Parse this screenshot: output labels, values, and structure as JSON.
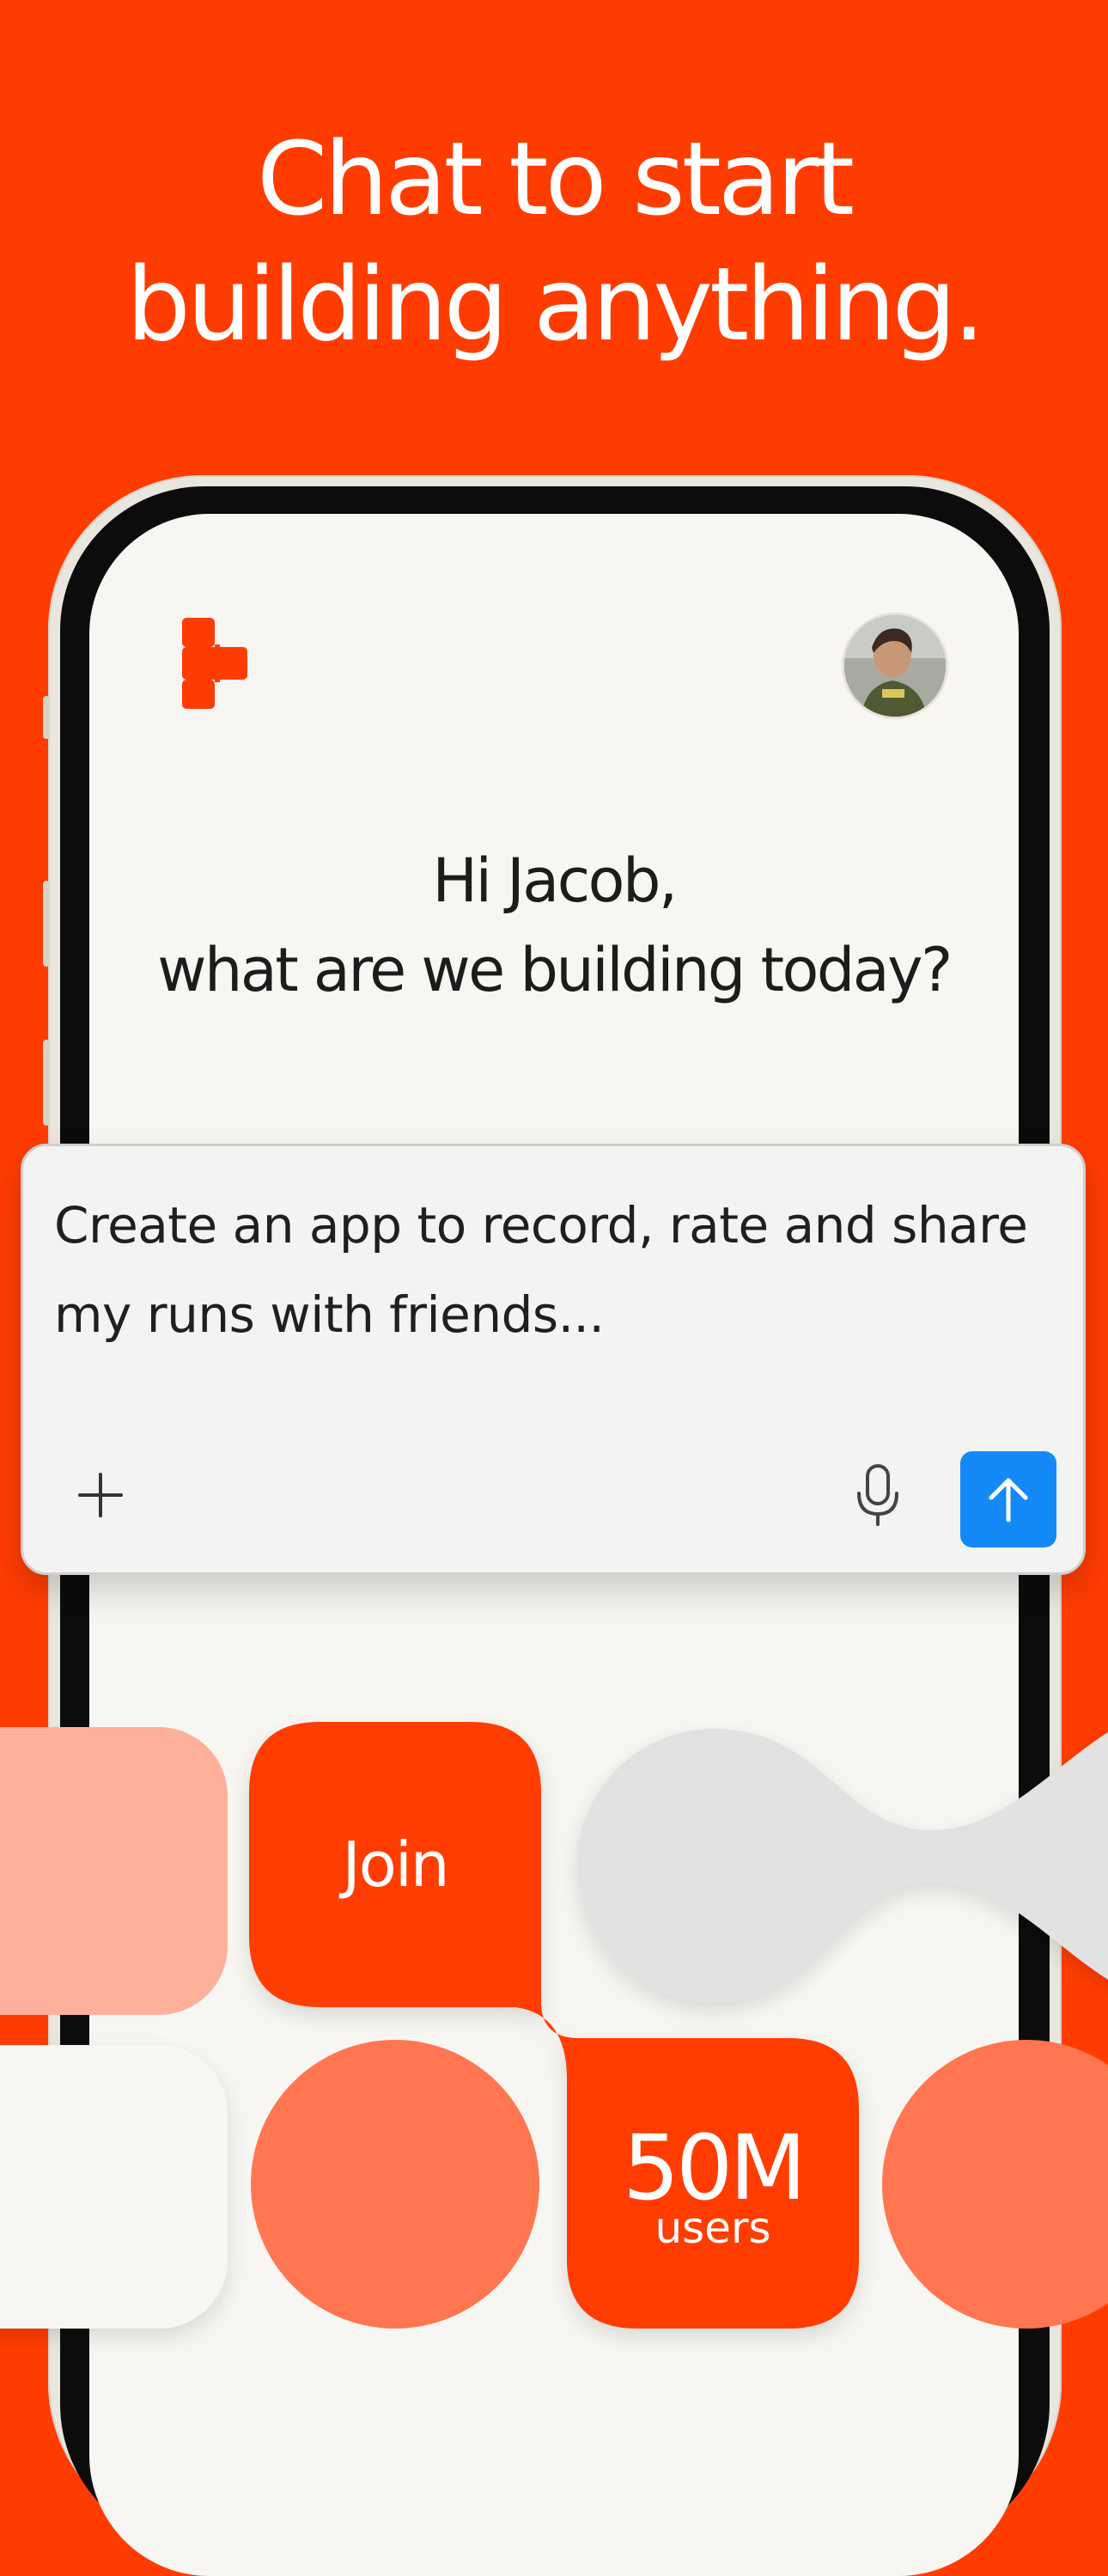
{
  "headline": {
    "line1": "Chat to start",
    "line2": "building anything."
  },
  "app": {
    "greeting_line1": "Hi Jacob,",
    "greeting_line2": "what are we building today?"
  },
  "prompt": {
    "text_line1": "Create an app to record, rate and share",
    "text_line2": "my runs with friends..."
  },
  "tiles": {
    "join_label": "Join",
    "users_count": "50M",
    "users_label": "users"
  },
  "icons": {
    "logo": "replit-logo",
    "add": "plus-icon",
    "mic": "microphone-icon",
    "send": "arrow-up-icon"
  },
  "colors": {
    "background": "#FF3C00",
    "accent": "#FF3C00",
    "send_button": "#1589F7",
    "screen": "#F8F6F2",
    "peach": "#FFB09A",
    "coral": "#FF7650",
    "grey_shape": "#E2E2E2"
  }
}
